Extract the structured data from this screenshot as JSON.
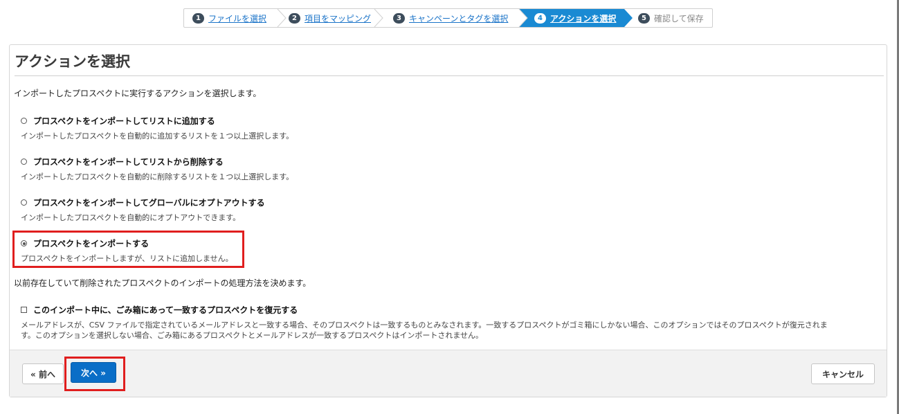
{
  "wizard": {
    "steps": [
      {
        "num": "1",
        "label": "ファイルを選択"
      },
      {
        "num": "2",
        "label": "項目をマッピング"
      },
      {
        "num": "3",
        "label": "キャンペーンとタグを選択"
      },
      {
        "num": "4",
        "label": "アクションを選択"
      },
      {
        "num": "5",
        "label": "確認して保存"
      }
    ],
    "active_color": "#1a8ad3"
  },
  "page": {
    "title": "アクションを選択",
    "intro": "インポートしたプロスペクトに実行するアクションを選択します。"
  },
  "options": [
    {
      "label": "プロスペクトをインポートしてリストに追加する",
      "desc": "インポートしたプロスペクトを自動的に追加するリストを１つ以上選択します。",
      "checked": false
    },
    {
      "label": "プロスペクトをインポートしてリストから削除する",
      "desc": "インポートしたプロスペクトを自動的に削除するリストを１つ以上選択します。",
      "checked": false
    },
    {
      "label": "プロスペクトをインポートしてグローバルにオプトアウトする",
      "desc": "インポートしたプロスペクトを自動的にオプトアウトできます。",
      "checked": false
    },
    {
      "label": "プロスペクトをインポートする",
      "desc": "プロスペクトをインポートしますが、リストに追加しません。",
      "checked": true
    }
  ],
  "deleted": {
    "intro": "以前存在していて削除されたプロスペクトのインポートの処理方法を決めます。",
    "checkbox_label": "このインポート中に、ごみ箱にあって一致するプロスペクトを復元する",
    "desc_line1": "メールアドレスが、CSV ファイルで指定されているメールアドレスと一致する場合、そのプロスペクトは一致するものとみなされます。一致するプロスペクトがゴミ箱にしかない場合、このオプションではそのプロスペクトが復元されま",
    "desc_line2": "す。このオプションを選択しない場合、ごみ箱にあるプロスペクトとメールアドレスが一致するプロスペクトはインポートされません。",
    "checked": false
  },
  "footer": {
    "prev_label": "« 前へ",
    "next_label": "次へ »",
    "cancel_label": "キャンセル"
  },
  "colors": {
    "primary": "#0a6ec7",
    "highlight": "#e01e1e"
  }
}
